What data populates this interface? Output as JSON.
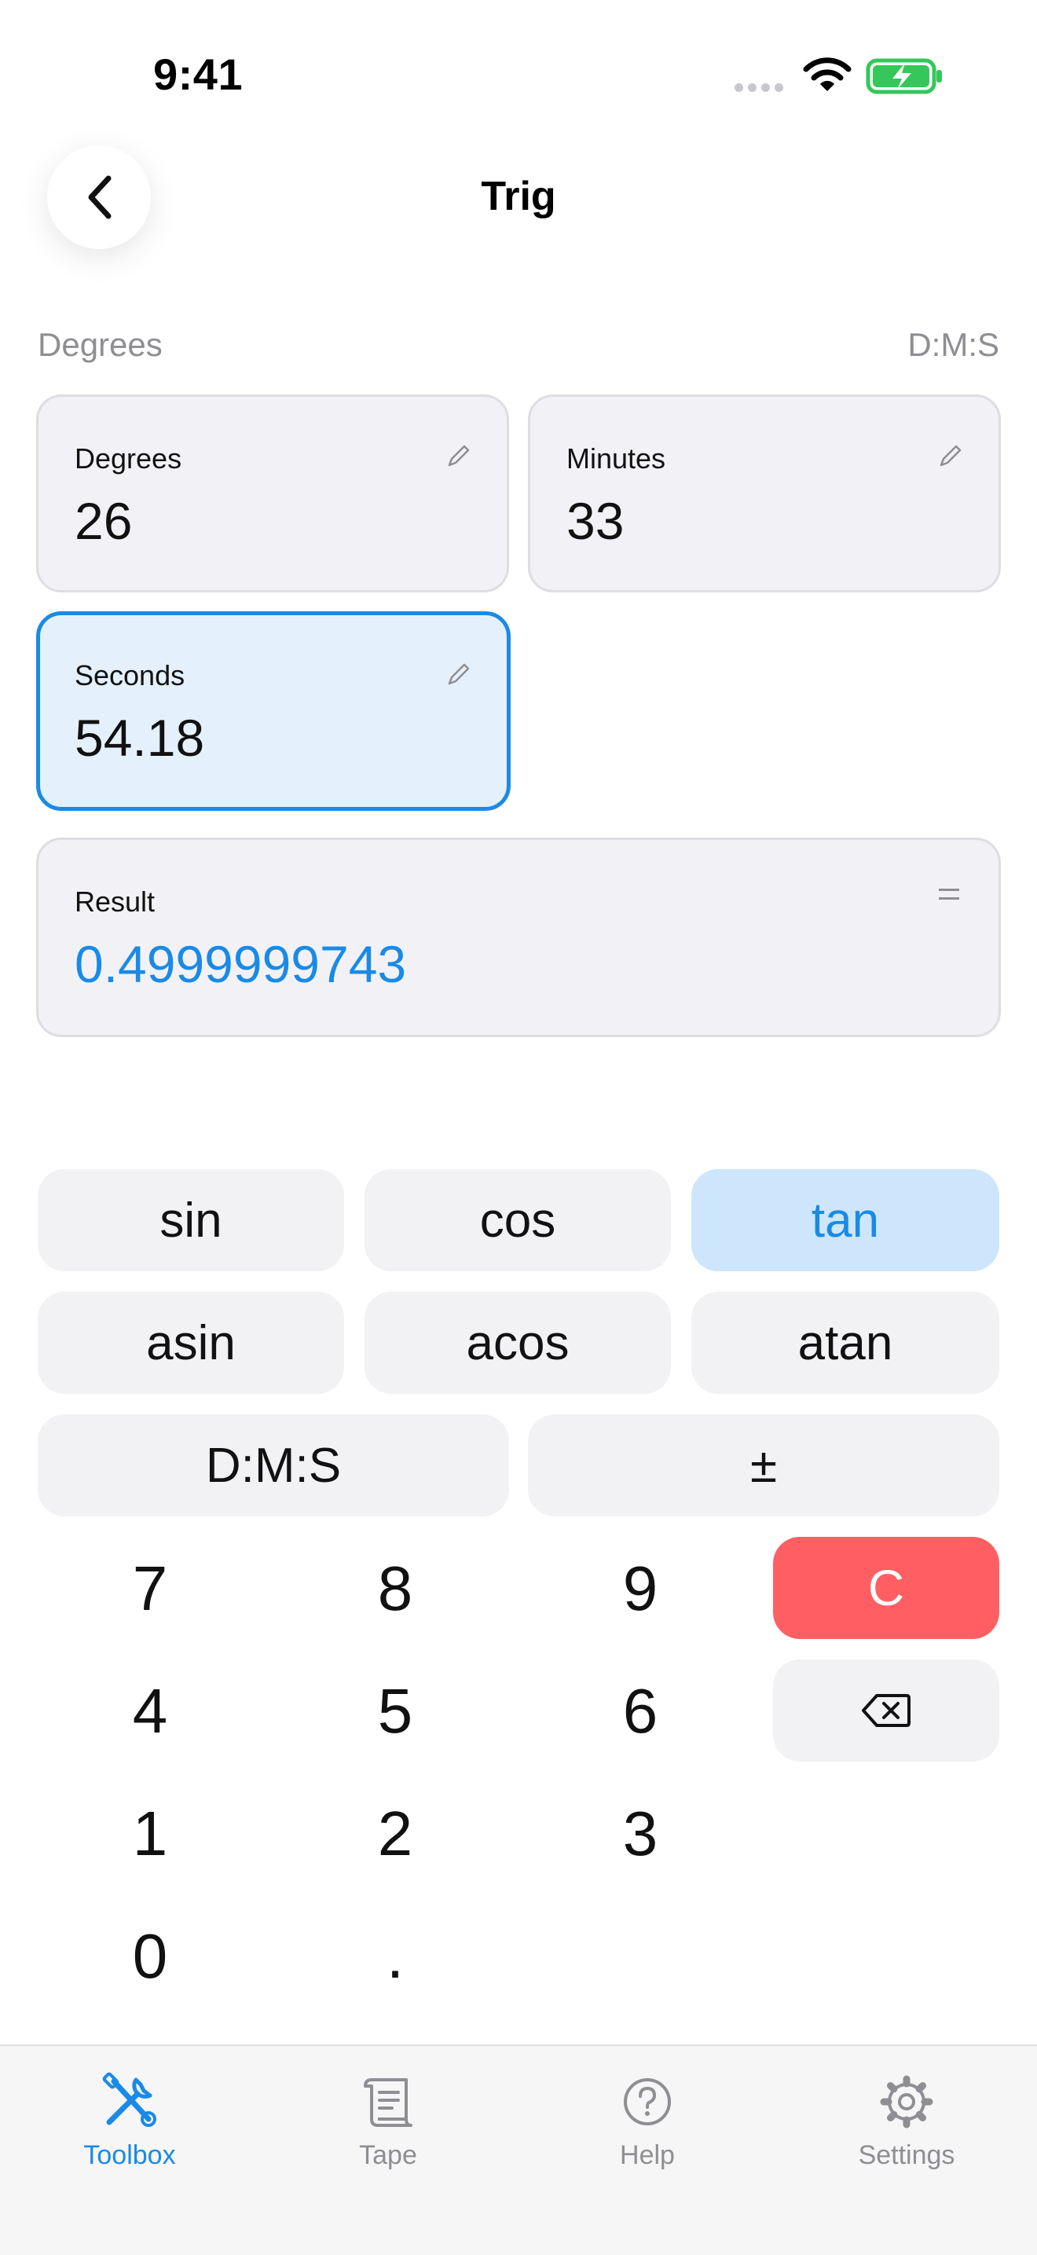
{
  "status_bar": {
    "time": "9:41"
  },
  "header": {
    "title": "Trig",
    "back_icon": "chevron-left-icon"
  },
  "section": {
    "left_label": "Degrees",
    "right_label": "D:M:S"
  },
  "inputs": {
    "degrees": {
      "label": "Degrees",
      "value": "26"
    },
    "minutes": {
      "label": "Minutes",
      "value": "33"
    },
    "seconds": {
      "label": "Seconds",
      "value": "54.18",
      "active": true
    }
  },
  "result": {
    "label": "Result",
    "value": "0.4999999743"
  },
  "functions": {
    "sin": "sin",
    "cos": "cos",
    "tan": "tan",
    "asin": "asin",
    "acos": "acos",
    "atan": "atan",
    "dms": "D:M:S",
    "plusminus": "±",
    "selected": "tan"
  },
  "keypad": {
    "k7": "7",
    "k8": "8",
    "k9": "9",
    "k4": "4",
    "k5": "5",
    "k6": "6",
    "k1": "1",
    "k2": "2",
    "k3": "3",
    "k0": "0",
    "dot": ".",
    "clear": "C"
  },
  "tabs": {
    "toolbox": "Toolbox",
    "tape": "Tape",
    "help": "Help",
    "settings": "Settings",
    "active": "Toolbox"
  },
  "colors": {
    "accent": "#1a8ae6",
    "accent_light": "#cde6fb",
    "clear_red": "#ff5f63",
    "battery_green": "#34c759"
  }
}
